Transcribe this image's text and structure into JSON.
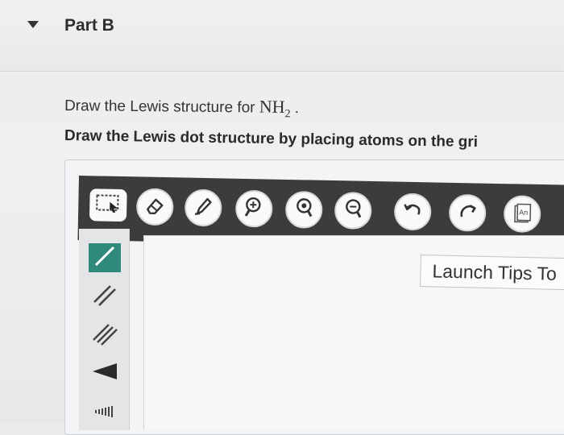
{
  "section": {
    "title": "Part B"
  },
  "question": {
    "prompt_prefix": "Draw the Lewis structure for",
    "formula_main": "NH",
    "formula_subscript": "2",
    "formula_suffix": ".",
    "instruction": "Draw the Lewis dot structure by placing atoms on the gri"
  },
  "toolbar": {
    "buttons": [
      {
        "name": "marquee-select-icon"
      },
      {
        "name": "eraser-icon"
      },
      {
        "name": "pencil-icon"
      },
      {
        "name": "zoom-in-icon"
      },
      {
        "name": "zoom-reset-icon"
      },
      {
        "name": "zoom-out-icon"
      },
      {
        "name": "undo-icon"
      },
      {
        "name": "redo-icon"
      },
      {
        "name": "template-icon",
        "label": "An"
      }
    ]
  },
  "side_tools": [
    {
      "name": "single-bond-icon",
      "active": true
    },
    {
      "name": "double-bond-icon"
    },
    {
      "name": "triple-bond-icon"
    },
    {
      "name": "wedge-bond-icon"
    },
    {
      "name": "hash-bond-icon"
    }
  ],
  "tips": {
    "label": "Launch Tips To"
  },
  "colors": {
    "toolbar_bg": "#3c3c3e",
    "active_tool": "#2f8a7c"
  }
}
